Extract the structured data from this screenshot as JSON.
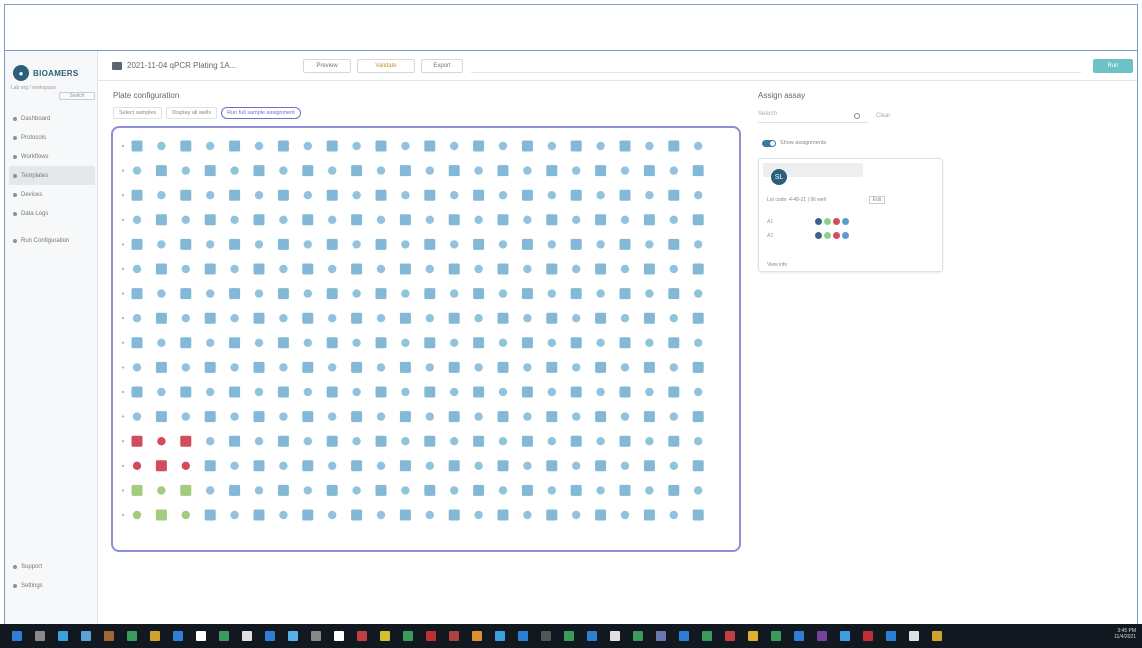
{
  "app": {
    "brand": "BIOAMERS",
    "org": "Lab org / workspace",
    "org_button": "Switch"
  },
  "sidebar": {
    "items": [
      {
        "label": "Dashboard",
        "active": false
      },
      {
        "label": "Protocols",
        "active": false
      },
      {
        "label": "Workflows",
        "active": false
      },
      {
        "label": "Templates",
        "active": true
      },
      {
        "label": "Devices",
        "active": false
      },
      {
        "label": "Data Logs",
        "active": false
      }
    ],
    "secondary": {
      "label": "Run Configuration"
    },
    "bottom": [
      {
        "label": "Support"
      },
      {
        "label": "Settings"
      }
    ]
  },
  "toolbar": {
    "file_title": "2021-11-04 qPCR Plating 1A...",
    "buttons": [
      "Preview",
      "Validate",
      "Export"
    ],
    "run_label": "Run"
  },
  "plate": {
    "section_title": "Plate configuration",
    "tabs": [
      {
        "label": "Select samples",
        "active": false
      },
      {
        "label": "Display all wells",
        "active": false
      },
      {
        "label": "Run full sample assignment",
        "active": true
      }
    ],
    "rows": 16,
    "cols": 24,
    "colors": {
      "well": "#92c2dd",
      "well_alt": "#83b8d6",
      "red": "#d24c5c",
      "green": "#a2cc7e",
      "empty": "#eef2f5"
    }
  },
  "assign": {
    "title": "Assign assay",
    "search_placeholder": "Search",
    "clear_label": "Clear",
    "toggle_label": "Show assignments",
    "card": {
      "avatar": "SL",
      "line": "Lot code: 4-48-21 | 96 well",
      "chip": "Edit",
      "rows": [
        "A1",
        "A2"
      ],
      "dot_colors": [
        "#3b6584",
        "#8fcf8b",
        "#d24c5c",
        "#5b9bd0"
      ],
      "footer": "View info"
    }
  },
  "taskbar": {
    "time": "3:45 PM",
    "date": "11/4/2021",
    "icon_colors": [
      "#2d7fd3",
      "#8a8a8a",
      "#3ca0e0",
      "#5aa3d8",
      "#a06830",
      "#3a9b5a",
      "#d0a030",
      "#2d7fd3",
      "#ffffff",
      "#3a9b5a",
      "#e0e0e0",
      "#2d7fd3",
      "#5ab0e8",
      "#888888",
      "#ffffff",
      "#c04040",
      "#d0c030",
      "#3a9b5a",
      "#c03030",
      "#b04040",
      "#e09030",
      "#3ca0e0",
      "#2d7fd3",
      "#555555",
      "#3a9b5a",
      "#2d7fd3",
      "#e0e0e0",
      "#3a9b5a",
      "#6a7ab0",
      "#2d7fd3",
      "#3a9b5a",
      "#c04040",
      "#e0b030",
      "#3a9b5a",
      "#2d7fd3",
      "#7a40a0",
      "#3ca0e0",
      "#c03030",
      "#2d7fd3",
      "#e0e0e0",
      "#d0a030"
    ]
  }
}
